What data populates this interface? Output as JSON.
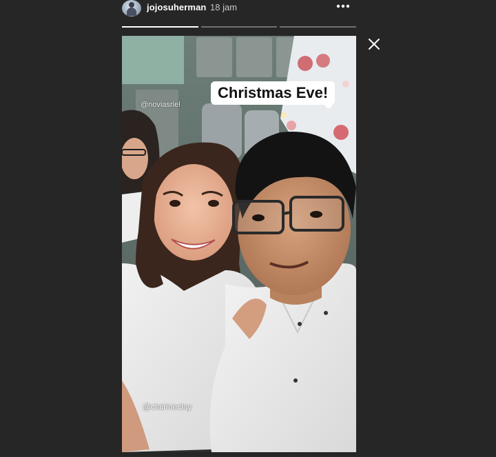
{
  "header": {
    "username": "jojosuherman",
    "timestamp": "18 jam",
    "avatar_icon": "user-avatar-icon",
    "more_icon": "more-horizontal-icon"
  },
  "progress": {
    "segments": [
      1,
      0,
      0
    ]
  },
  "close_icon": "close-icon",
  "story": {
    "sticker_text": "Christmas Eve!",
    "mention_top": "@noviasriel",
    "mention_bottom": "@clairineclay"
  },
  "colors": {
    "background": "#262626",
    "text": "#ffffff",
    "timestamp": "#c9c9c9",
    "sticker_bg": "#ffffff"
  }
}
